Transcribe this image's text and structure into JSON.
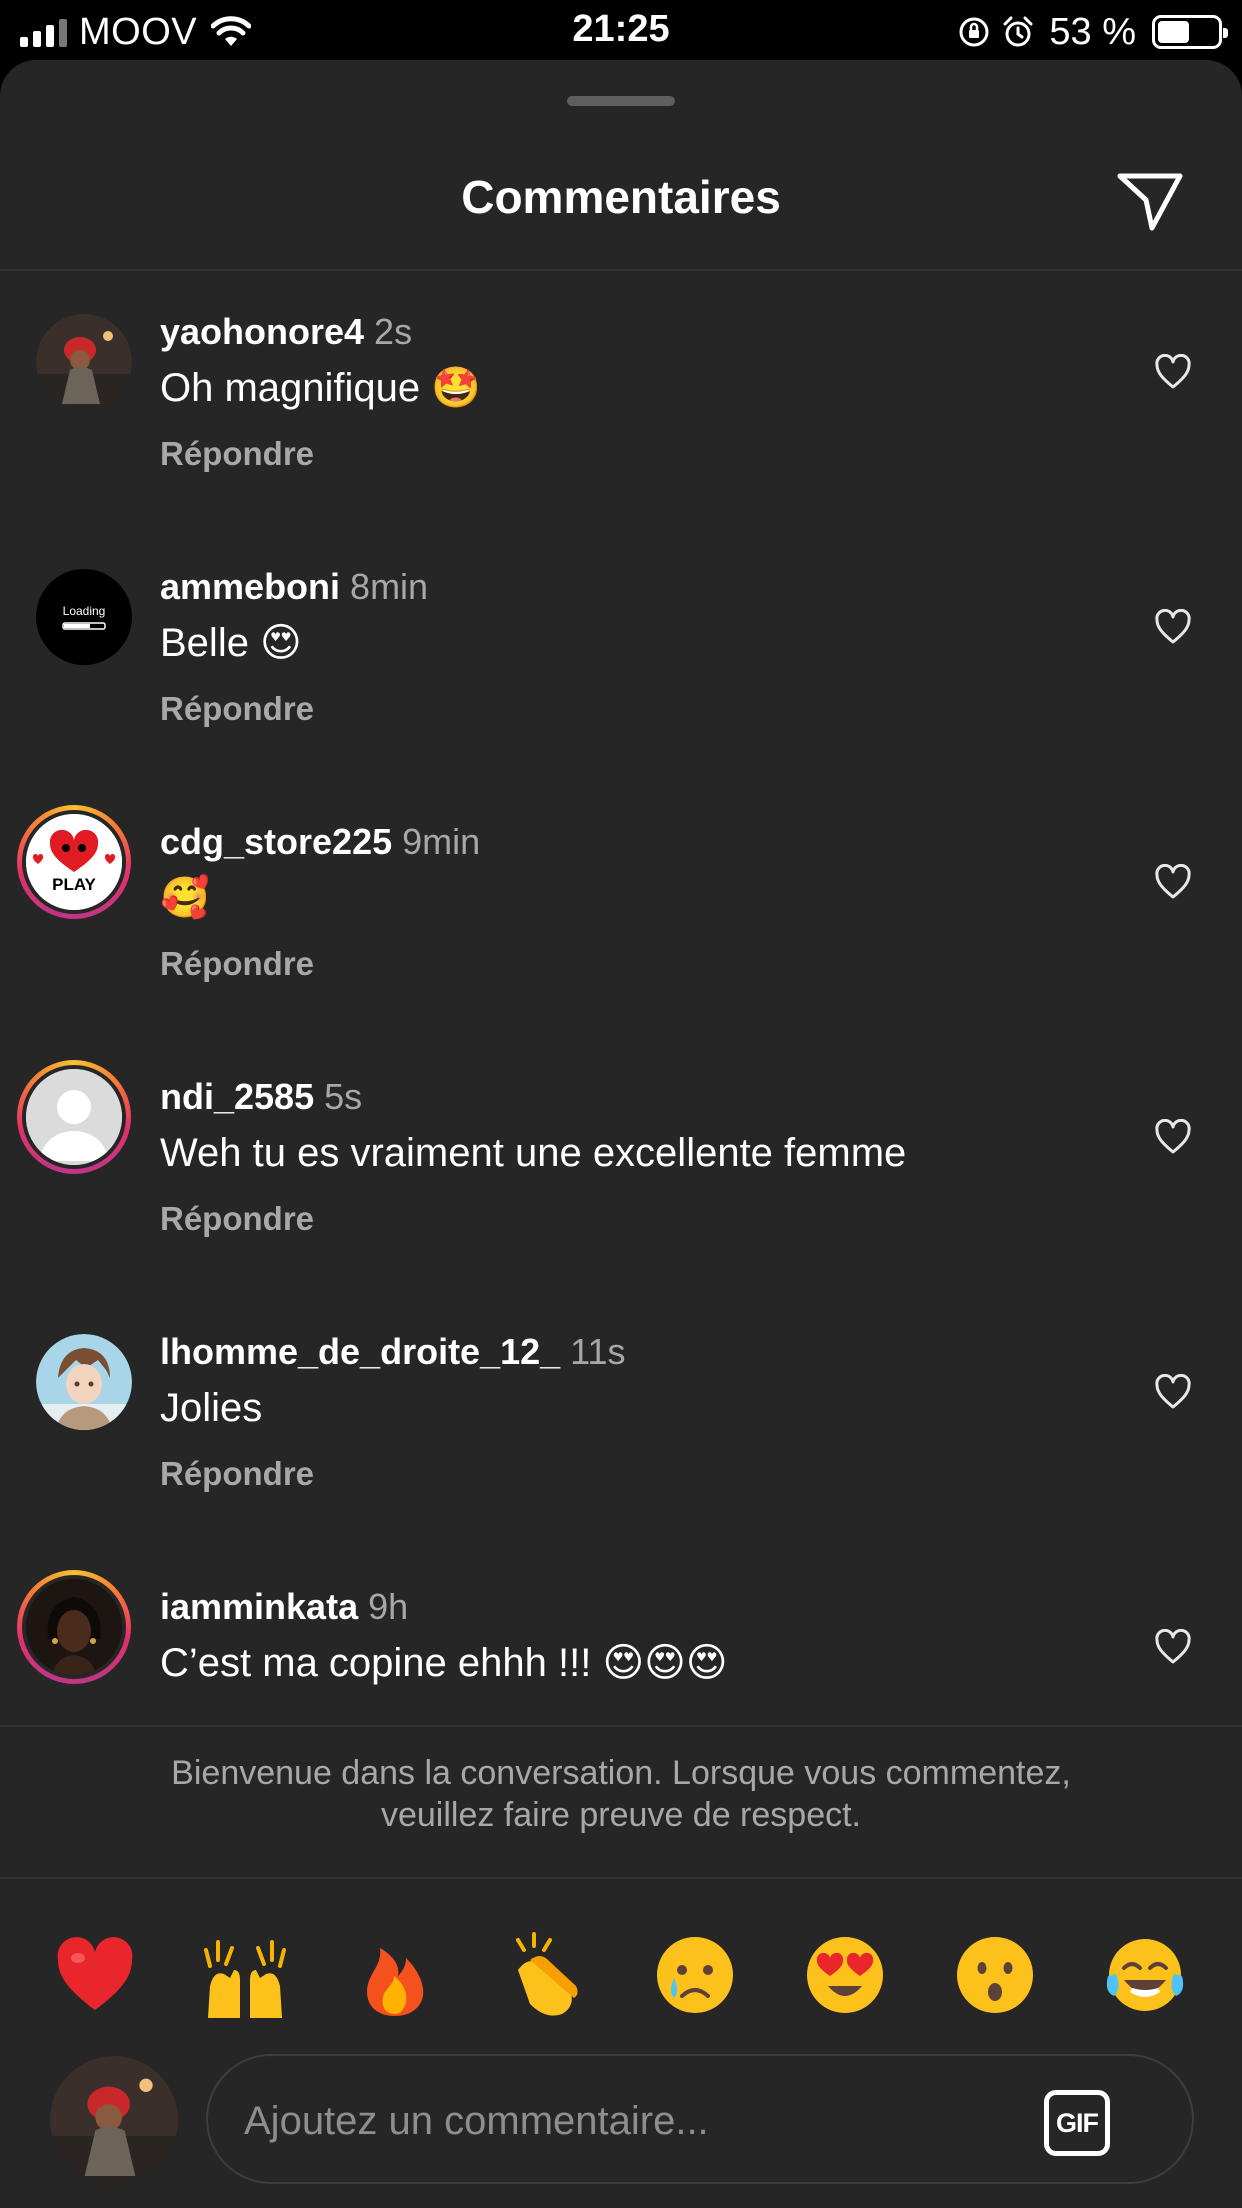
{
  "status_bar": {
    "carrier": "MOOV",
    "time": "21:25",
    "battery_percent": "53 %",
    "battery_level": 0.53,
    "icons": [
      "signal-icon",
      "wifi-icon",
      "orientation-lock-icon",
      "alarm-icon",
      "battery-icon"
    ]
  },
  "header": {
    "title": "Commentaires",
    "send_icon": "paper-plane-icon"
  },
  "comments": [
    {
      "username": "yaohonore4",
      "time": "2s",
      "text": "Oh magnifique 🤩",
      "reply_label": "Répondre",
      "story_ring": false,
      "avatar": "red-hat-person-photo"
    },
    {
      "username": "ammeboni",
      "time": "8min",
      "text": "Belle 😍",
      "reply_label": "Répondre",
      "story_ring": false,
      "avatar": "loading-badge",
      "avatar_text": "Loading"
    },
    {
      "username": "cdg_store225",
      "time": "9min",
      "text": "🥰",
      "reply_label": "Répondre",
      "story_ring": true,
      "avatar": "play-heart-logo",
      "avatar_text": "PLAY"
    },
    {
      "username": "ndi_2585",
      "time": "5s",
      "text": "Weh tu es vraiment une excellente femme",
      "reply_label": "Répondre",
      "story_ring": true,
      "avatar": "default-profile"
    },
    {
      "username": "lhomme_de_droite_12_",
      "time": "11s",
      "text": "Jolies",
      "reply_label": "Répondre",
      "story_ring": false,
      "avatar": "anime-character"
    },
    {
      "username": "iamminkata",
      "time": "9h",
      "text": "C’est ma copine ehhh !!! 😍😍😍",
      "reply_label": "",
      "story_ring": true,
      "avatar": "portrait-photo"
    }
  ],
  "welcome_text": "Bienvenue dans la conversation. Lorsque vous commentez, veuillez faire preuve de respect.",
  "quick_reactions": [
    "❤️",
    "🙌",
    "🔥",
    "👏",
    "😢",
    "😍",
    "😮",
    "😂"
  ],
  "composer": {
    "placeholder": "Ajoutez un commentaire...",
    "gif_label": "GIF"
  },
  "colors": {
    "sheet_bg": "#262626",
    "secondary_text": "#a8a8a8",
    "story_ring": [
      "#f9c22e",
      "#e1306c",
      "#c13584"
    ]
  }
}
